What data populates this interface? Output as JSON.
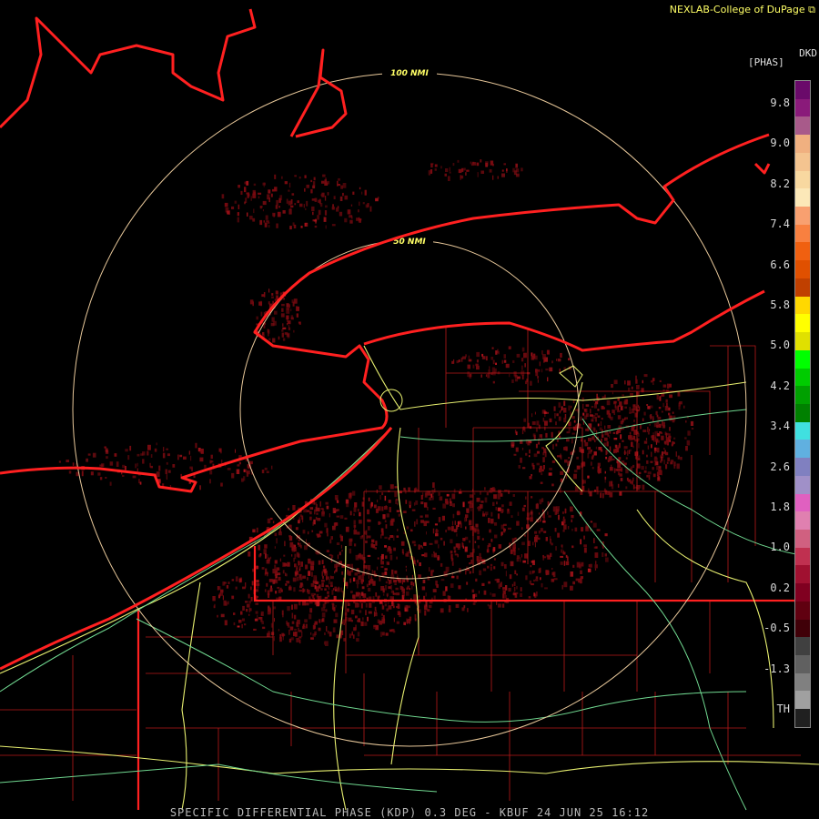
{
  "credit": "NEXLAB-College of DuPage",
  "footer": "SPECIFIC DIFFERENTIAL PHASE (KDP) 0.3 DEG - KBUF 24 JUN 25 16:12",
  "legend": {
    "product": "DKD",
    "units": "[PHAS]",
    "ticks": [
      "9.8",
      "9.0",
      "8.2",
      "7.4",
      "6.6",
      "5.8",
      "5.0",
      "4.2",
      "3.4",
      "2.6",
      "1.8",
      "1.0",
      "0.2",
      "-0.5",
      "-1.3",
      "TH"
    ],
    "colors": [
      "#6a0a6a",
      "#8a1a7a",
      "#a85a8a",
      "#f0b080",
      "#f4c490",
      "#f8d8a0",
      "#fce8b8",
      "#f8a070",
      "#f88040",
      "#f06010",
      "#e05000",
      "#c04000",
      "#ffd800",
      "#ffff00",
      "#e0e000",
      "#00ff00",
      "#00cc00",
      "#00a000",
      "#008000",
      "#40e0e0",
      "#60b0e0",
      "#8080c0",
      "#a090c8",
      "#e060c0",
      "#e080b0",
      "#d06080",
      "#c03050",
      "#a01030",
      "#800020",
      "#600010",
      "#400008",
      "#404040",
      "#606060",
      "#808080",
      "#a0a0a0",
      "#202020"
    ],
    "accent": "#ffff66"
  },
  "map": {
    "rings": [
      {
        "label": "100 NMI"
      },
      {
        "label": "50 NMI"
      }
    ],
    "colors": {
      "coast": "#ff2020",
      "county": "#c01818",
      "highway": "#e8f070",
      "highway2": "#70d890",
      "ring": "#e8c89a",
      "echo": "#8a0a12"
    }
  }
}
